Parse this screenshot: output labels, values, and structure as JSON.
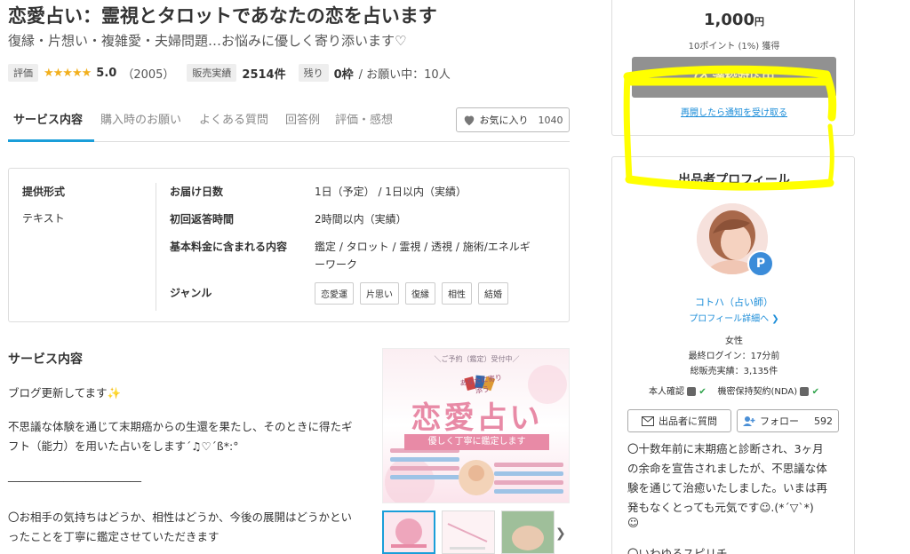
{
  "service": {
    "title": "恋愛占い：霊視とタロットであなたの恋を占います",
    "subtitle": "復縁・片想い・複雑愛・夫婦問題…お悩みに優しく寄り添います♡"
  },
  "stats": {
    "rating_label": "評価",
    "stars": "★★★★★",
    "rating": "5.0",
    "review_count": "（2005）",
    "sales_label": "販売実績",
    "sales_value": "2514件",
    "remaining_label": "残り",
    "remaining_value": "0枠",
    "in_progress": "/ お願い中：10人"
  },
  "tabs": [
    {
      "label": "サービス内容",
      "active": true
    },
    {
      "label": "購入時のお願い"
    },
    {
      "label": "よくある質問"
    },
    {
      "label": "回答例"
    },
    {
      "label": "評価・感想"
    }
  ],
  "favorite": {
    "label": "お気に入り",
    "count": "1040",
    "icon": "heart-icon"
  },
  "spec": {
    "format_label": "提供形式",
    "format_value": "テキスト",
    "delivery_label": "お届け日数",
    "delivery_value": "1日（予定） / 1日以内（実績）",
    "reply_label": "初回返答時間",
    "reply_value": "2時間以内（実績）",
    "included_label": "基本料金に含まれる内容",
    "included_line1": "鑑定 / タロット / 霊視 / 透視 / 施術/エネルギ",
    "included_line2": "ーワーク",
    "genre_label": "ジャンル",
    "genres": [
      "恋愛運",
      "片思い",
      "復縁",
      "相性",
      "結婚"
    ]
  },
  "description": {
    "heading": "サービス内容",
    "lines": [
      "ブログ更新してます✨",
      "不思議な体験を通じて末期癌からの生還を果たし、そのときに得たギ",
      "フト（能力）を用いた占いをします´♫♡´ß*:°",
      "________________________",
      "〇お相手の気持ちはどうか、相性はどうか、今後の展開はどうかとい",
      "ったことを丁寧に鑑定させていただきます"
    ]
  },
  "thumbnail": {
    "banner": "＼ご予約（鑑定）受付中／",
    "tagline": "あなたに寄り添う",
    "main_text": "恋愛占い",
    "sub_text": "優しく丁寧に鑑定します"
  },
  "purchase": {
    "price": "1,000",
    "currency": "円",
    "points": "10ポイント (1%) 獲得",
    "soldout_label": "満枠対応中",
    "notify_label": "再開したら通知を受け取る"
  },
  "profile": {
    "heading": "出品者プロフィール",
    "badge": "P",
    "name": "コトハ（占い師）",
    "detail_link": "プロフィール詳細へ ❯",
    "gender": "女性",
    "last_login": "最終ログイン：17分前",
    "total_sales": "総販売実績：3,135件",
    "identity_label": "本人確認",
    "nda_label": "機密保持契約(NDA)",
    "check": "✔",
    "ask_label": "出品者に質問",
    "follow_label": "フォロー",
    "follow_count": "592",
    "intro": [
      "〇十数年前に末期癌と診断され、3ヶ月",
      "の余命を宣告されましたが、不思議な体",
      "験を通じて治癒いたしました。いまは再",
      "発もなくとっても元気です☺.(*´▽`*)",
      "☺",
      "〇いわゆるスピリチ"
    ]
  },
  "colors": {
    "accent": "#1a9ed9",
    "link": "#1a8cd8",
    "star": "#f2b01e",
    "soldout_bg": "#919191",
    "highlight": "#ffff00"
  }
}
